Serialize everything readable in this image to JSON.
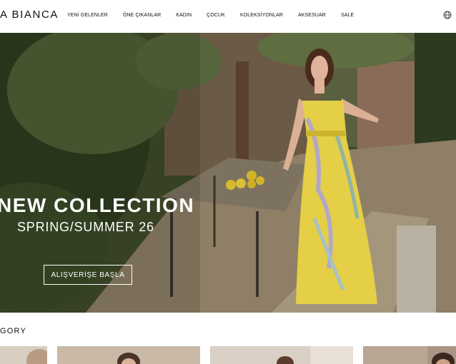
{
  "header": {
    "logo": "A BIANCA",
    "nav": [
      "YENİ GELENLER",
      "ÖNE ÇIKANLAR",
      "KADIN",
      "ÇOCUK",
      "KOLEKSİYONLAR",
      "AKSESUAR",
      "SALE"
    ]
  },
  "hero": {
    "title": "NEW COLLECTION",
    "subtitle": "SPRING/SUMMER 26",
    "cta": "ALIŞVERİŞE BAŞLA"
  },
  "category": {
    "title": "GORY"
  },
  "icons": {
    "language": "globe-icon"
  },
  "colors": {
    "text": "#111111",
    "hero_overlay": "#ffffff"
  }
}
